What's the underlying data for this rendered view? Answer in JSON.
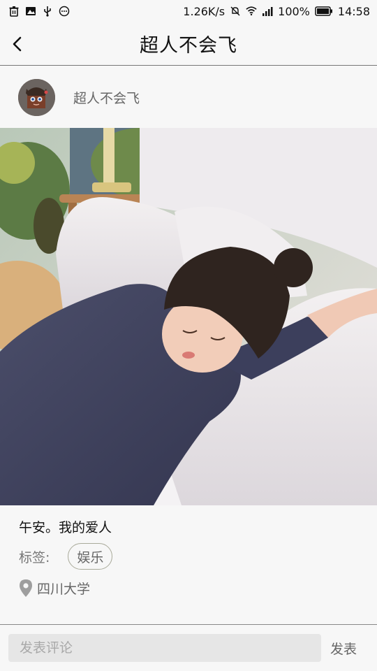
{
  "status_bar": {
    "network_speed": "1.26K/s",
    "battery": "100%",
    "time": "14:58",
    "left_icons": [
      "trash-icon",
      "image-icon",
      "usb-icon",
      "more-dots-icon"
    ],
    "right_icons": [
      "mute-icon",
      "wifi-icon",
      "signal-icon",
      "battery-icon"
    ]
  },
  "header": {
    "title": "超人不会飞",
    "back_icon": "chevron-left-icon"
  },
  "author": {
    "name": "超人不会飞"
  },
  "post": {
    "image_description": "photo",
    "caption": "午安。我的爱人",
    "tag_label": "标签:",
    "tag": "娱乐",
    "location_icon": "location-pin-icon",
    "location": "四川大学"
  },
  "comment_bar": {
    "placeholder": "发表评论",
    "value": "",
    "send_label": "发表"
  },
  "colors": {
    "background": "#f7f7f7",
    "divider": "#777777",
    "input_bg": "#e6e6e6",
    "tag_border": "#a9aa9a"
  }
}
